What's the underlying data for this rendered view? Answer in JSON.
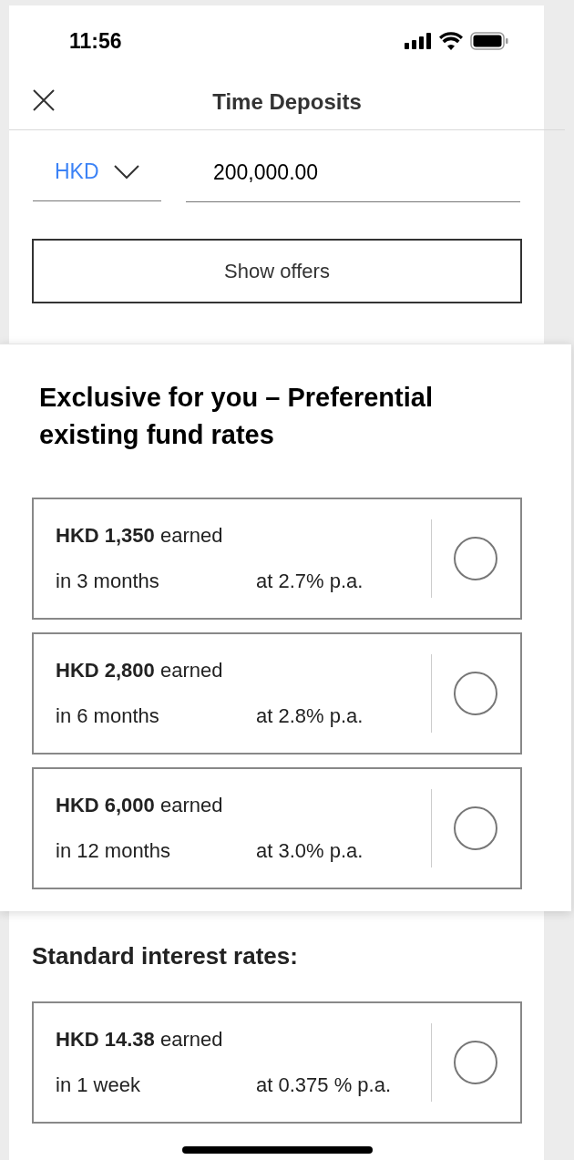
{
  "status_bar": {
    "time": "11:56"
  },
  "header": {
    "title": "Time Deposits"
  },
  "form": {
    "currency": "HKD",
    "amount": "200,000.00",
    "button": "Show offers"
  },
  "exclusive": {
    "title": "Exclusive for you –  Preferential existing fund rates",
    "offers": [
      {
        "earned": "**HKD 1,350** earned",
        "term": "in 3 months",
        "rate": "at 2.7% p.a.",
        "selected": false
      },
      {
        "earned": "**HKD 2,800** earned",
        "term": "in 6 months",
        "rate": "at 2.8% p.a.",
        "selected": false
      },
      {
        "earned": "**HKD 6,000** earned",
        "term": "in 12 months",
        "rate": "at 3.0% p.a.",
        "selected": false
      }
    ]
  },
  "standard": {
    "title": "Standard interest rates:",
    "offers": [
      {
        "earned": "**HKD 14.38** earned",
        "term": "in 1 week",
        "rate": "at 0.375 % p.a.",
        "selected": false
      }
    ]
  }
}
